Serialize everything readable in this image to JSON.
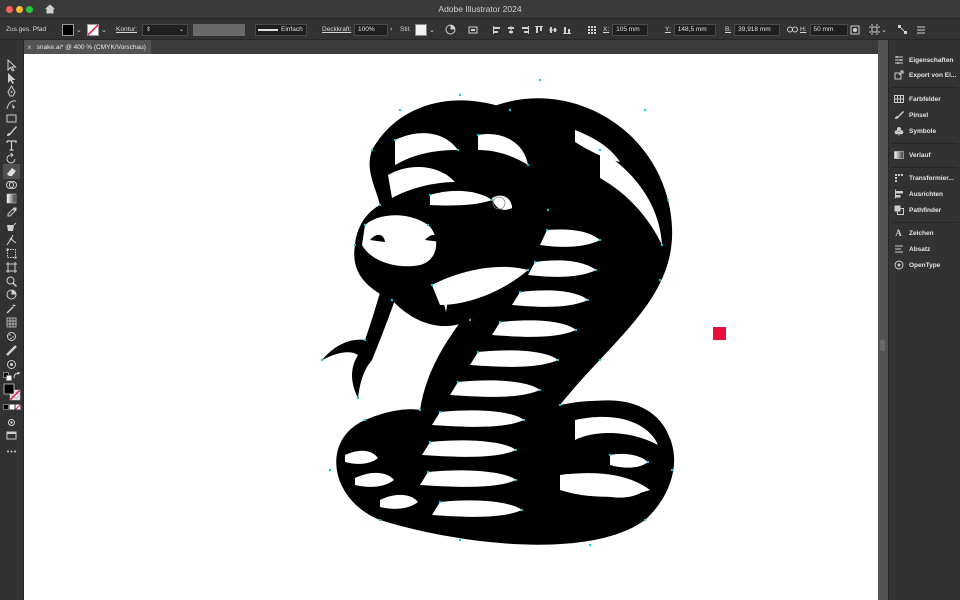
{
  "app": {
    "title": "Adobe Illustrator 2024"
  },
  "control_bar": {
    "selection_type": "Zus.ges. Pfad",
    "stroke_label": "Kontur:",
    "stroke_style": "Einfach",
    "opacity_label": "Deckkraft:",
    "opacity_value": "100%",
    "style_label": "Stil:",
    "x_label": "X:",
    "x_value": "105 mm",
    "y_label": "Y:",
    "y_value": "148,5 mm",
    "w_label": "B:",
    "w_value": "39,918 mm",
    "h_label": "H:",
    "h_value": "50 mm"
  },
  "document": {
    "tab_title": "snake.ai* @ 400 % (CMYK/Vorschau)",
    "close_glyph": "×"
  },
  "panels": [
    {
      "label": "Eigenschaften",
      "icon": "properties-icon"
    },
    {
      "label": "Export von El...",
      "icon": "export-icon"
    },
    {
      "label": "Farbfelder",
      "icon": "swatches-icon"
    },
    {
      "label": "Pinsel",
      "icon": "brushes-icon"
    },
    {
      "label": "Symbole",
      "icon": "symbols-icon"
    },
    {
      "label": "Verlauf",
      "icon": "gradient-icon"
    },
    {
      "label": "Transformier...",
      "icon": "transform-icon"
    },
    {
      "label": "Ausrichten",
      "icon": "align-icon"
    },
    {
      "label": "Pathfinder",
      "icon": "pathfinder-icon"
    },
    {
      "label": "Zeichen",
      "icon": "character-icon"
    },
    {
      "label": "Absatz",
      "icon": "paragraph-icon"
    },
    {
      "label": "OpenType",
      "icon": "opentype-icon"
    }
  ],
  "colors": {
    "accent_red": "#e8103a",
    "path_cyan": "#16c9d2",
    "canvas": "#ffffff",
    "ui_dark": "#323232"
  }
}
